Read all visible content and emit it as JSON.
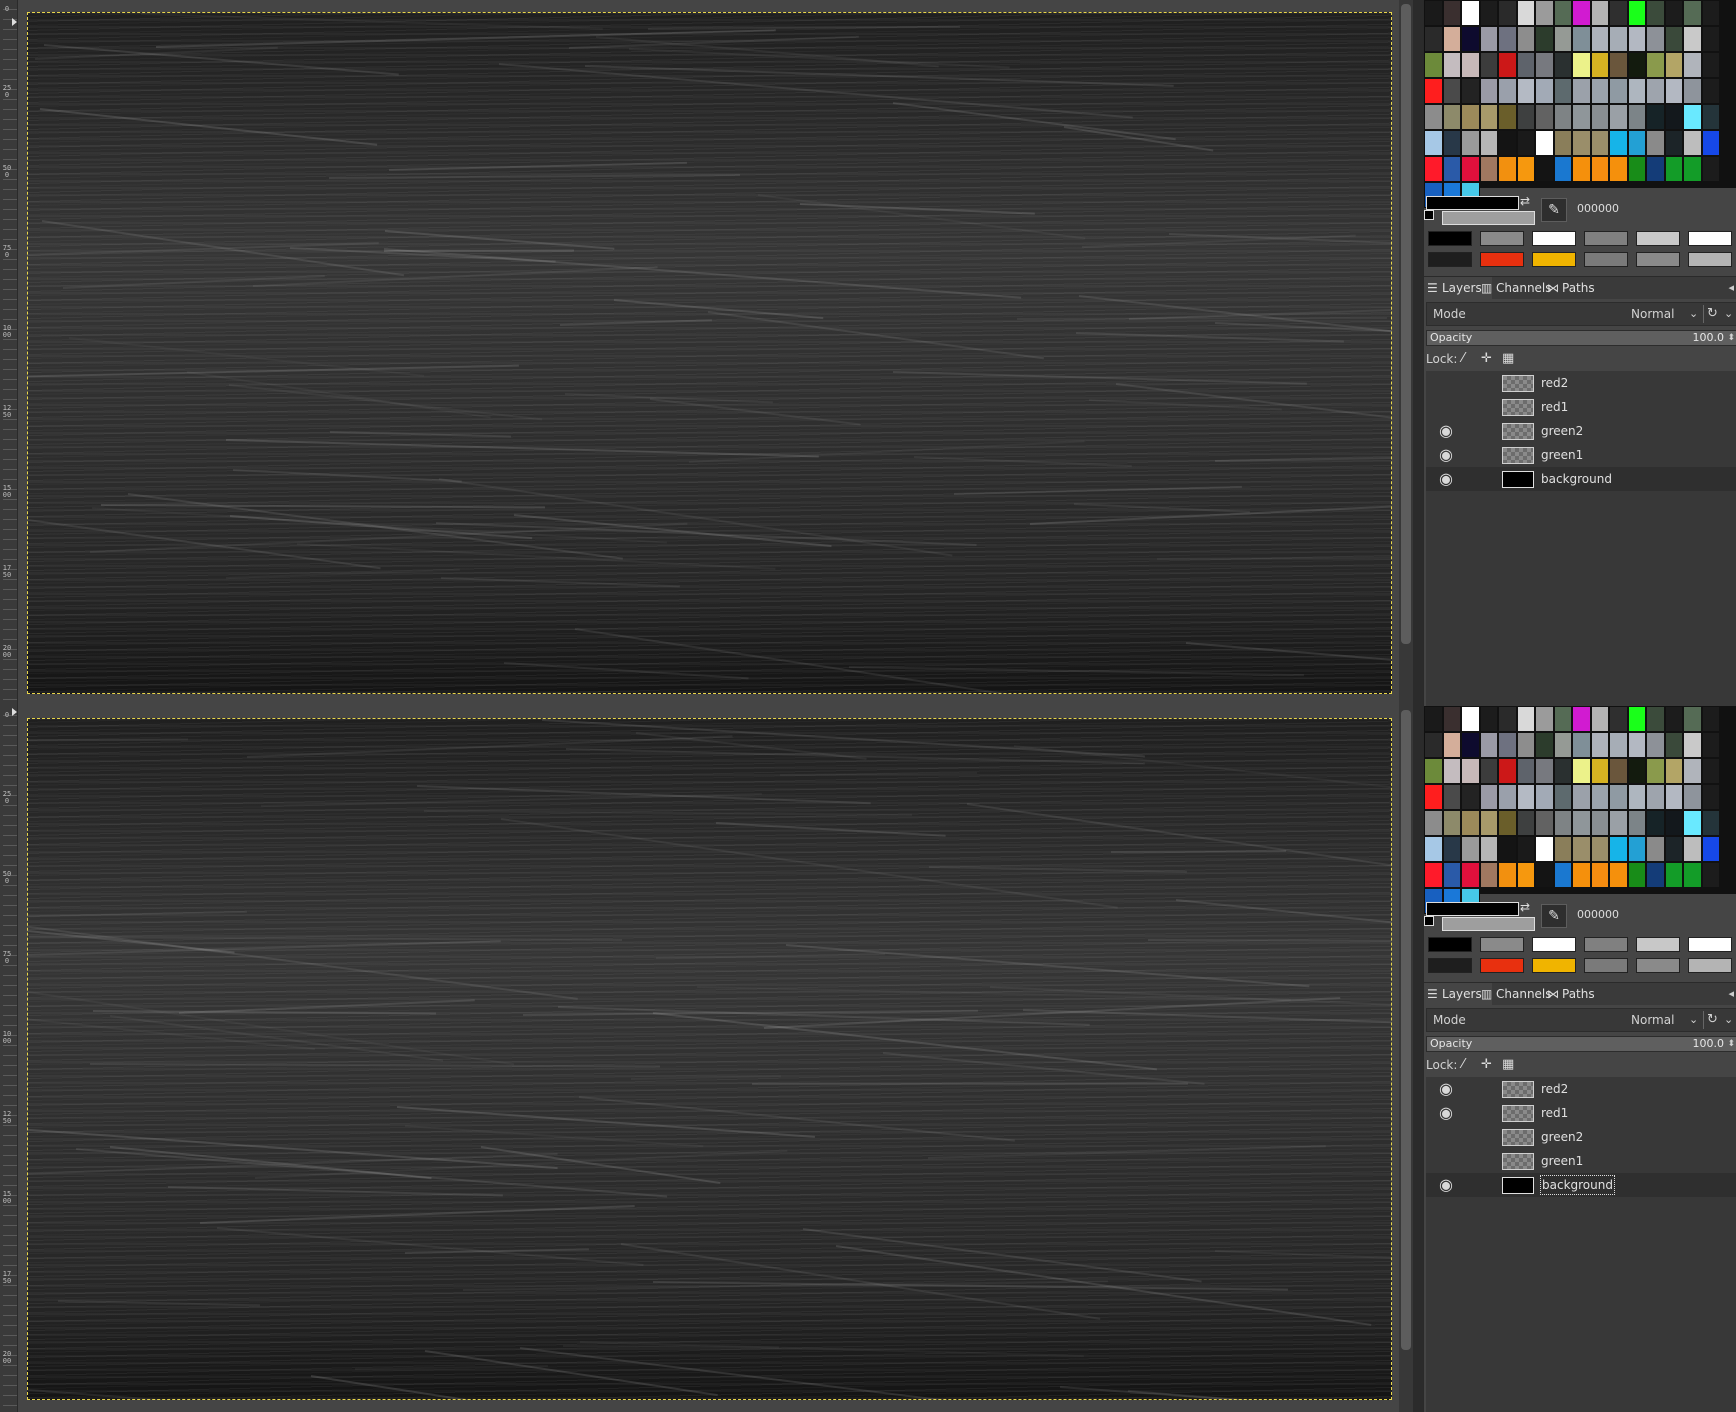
{
  "ruler_labels": [
    "0",
    "250",
    "500",
    "750",
    "1000",
    "1250",
    "1500",
    "1750",
    "2000"
  ],
  "palette_colors": [
    "#1a1a1a",
    "#3a2f2f",
    "#ffffff",
    "#1c1c1c",
    "#2a2a2a",
    "#d9d9d9",
    "#9b9b9b",
    "#556b55",
    "#d11bd1",
    "#b3b3b3",
    "#2f2f2f",
    "#1aff1a",
    "#3b4b3b",
    "#1c1c1c",
    "#556b55",
    "#1c1c1c",
    "#2a2a2a",
    "#d4ae9a",
    "#0e0b2e",
    "#9a9aa6",
    "#6e7180",
    "#8d8d8d",
    "#2c3c2c",
    "#959a95",
    "#7f8f98",
    "#aeb2bb",
    "#a6adb6",
    "#b3b8c2",
    "#8d9198",
    "#3a493a",
    "#c9c9c9",
    "#1c1c1c",
    "#6c8a3a",
    "#c4bcbf",
    "#c7b8b8",
    "#3c3c3c",
    "#cc1818",
    "#5e636b",
    "#77797f",
    "#2a3030",
    "#ecf28a",
    "#d4b122",
    "#6a563c",
    "#131b0e",
    "#8a9a4c",
    "#b3a566",
    "#b0b4bb",
    "#1c1c1c",
    "#ff1e1e",
    "#4a4a4a",
    "#232323",
    "#9a9aa6",
    "#9aa0ab",
    "#b4bac4",
    "#a2aab6",
    "#5d6a6e",
    "#9ba1aa",
    "#9aa3ad",
    "#8f9aa3",
    "#aeb6bf",
    "#9ea4ad",
    "#b3b8c2",
    "#8e949c",
    "#1c1c1c",
    "#8c8c8c",
    "#8d8a6a",
    "#9c8a5a",
    "#a89a6a",
    "#6a5e2a",
    "#3e4040",
    "#626262",
    "#7e8385",
    "#8f969a",
    "#898e92",
    "#9aa0a6",
    "#7c8488",
    "#162327",
    "#13181c",
    "#69e9ff",
    "#24343a",
    "#a6c8e6",
    "#283848",
    "#9a9a9a",
    "#b6b6b6",
    "#141414",
    "#1a1a1a",
    "#ffffff",
    "#8a7e5a",
    "#9a8e6a",
    "#9a8e6a",
    "#16b4e8",
    "#23a0d4",
    "#8a8a8a",
    "#1c2428",
    "#bdbdbd",
    "#1648e8",
    "#ff1a2a",
    "#2a5aa8",
    "#e0103c",
    "#a07860",
    "#f2900f",
    "#f6980e",
    "#141414",
    "#1a78d0",
    "#f5900c",
    "#f58c10",
    "#f5900c",
    "#188c18",
    "#143c78",
    "#139c28",
    "#139c28",
    "#1c1c1c",
    "#1860c0",
    "#1a78d8",
    "#46c8e8"
  ],
  "dock": {
    "fg_color": "#000000",
    "bg_color": "#9e9e9e",
    "hex_value": "000000",
    "recent_colors": [
      "#000000",
      "#8a8a8a",
      "#ffffff",
      "#808080",
      "#c8c8c8",
      "#ffffff",
      "#1e1e1e",
      "#e8300f",
      "#f0b400",
      "#7a7a7a",
      "#8a8a8a",
      "#b4b4b4"
    ],
    "tabs": {
      "layers": "Layers",
      "channels": "Channels",
      "paths": "Paths"
    },
    "mode": {
      "label": "Mode",
      "value": "Normal"
    },
    "opacity": {
      "label": "Opacity",
      "value": "100.0"
    },
    "lock_label": "Lock:"
  },
  "windows": [
    {
      "layers": [
        {
          "name": "red2",
          "visible": false,
          "thumb": "transparent"
        },
        {
          "name": "red1",
          "visible": false,
          "thumb": "transparent"
        },
        {
          "name": "green2",
          "visible": true,
          "thumb": "transparent"
        },
        {
          "name": "green1",
          "visible": true,
          "thumb": "transparent"
        },
        {
          "name": "background",
          "visible": true,
          "thumb": "black",
          "selected": true
        }
      ]
    },
    {
      "layers": [
        {
          "name": "red2",
          "visible": true,
          "thumb": "transparent"
        },
        {
          "name": "red1",
          "visible": true,
          "thumb": "transparent"
        },
        {
          "name": "green2",
          "visible": false,
          "thumb": "transparent"
        },
        {
          "name": "green1",
          "visible": false,
          "thumb": "transparent"
        },
        {
          "name": "background",
          "visible": true,
          "thumb": "black",
          "selected": true,
          "focused": true
        }
      ]
    }
  ]
}
